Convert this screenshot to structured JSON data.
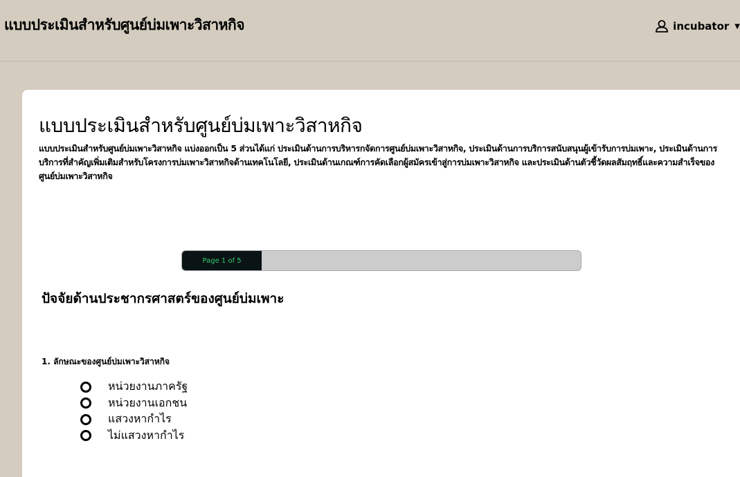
{
  "header": {
    "app_title": "แบบประเมินสำหรับศูนย์บ่มเพาะวิสาหกิจ",
    "user_name": "incubator",
    "user_icon": "user-icon",
    "caret_icon": "caret-down-icon"
  },
  "survey": {
    "title": "แบบประเมินสำหรับศูนย์บ่มเพาะวิสาหกิจ",
    "description": "แบบประเมินสำหรับศูนย์บ่มเพาะวิสาหกิจ แบ่งออกเป็น 5 ส่วนได้แก่ ประเมินด้านการบริหารกจัดการศูนย์บ่มเพาะวิสาหกิจ, ประเมินด้านการบริการสนับสนุนผู้เข้ารับการบ่มเพาะ, ประเมินด้านการบริการที่สำคัญเพิ่มเติมสำหรับโครงการบ่มเพาะวิสาหกิจด้านเทคโนโลยี, ประเมินด้านเกณฑ์การคัดเลือกผู้สมัครเข้าสู่การบ่มเพาะวิสาหกิจ และประเมินด้านตัวชี้วัดผลสัมฤทธิ์และความสำเร็จของศูนย์บ่มเพาะวิสาหกิจ"
  },
  "progress": {
    "label": "Page 1 of 5",
    "fraction": 0.2
  },
  "page": {
    "title": "ปัจจัยด้านประชากรศาสตร์ของศูนย์บ่มเพาะ"
  },
  "question": {
    "text": "1. ลักษณะของศูนย์บ่มเพาะวิสาหกิจ",
    "options": [
      "หน่วยงานภาครัฐ",
      "หน่วยงานเอกชน",
      "แสวงหากำไร",
      "ไม่แสวงหากำไร"
    ]
  },
  "colors": {
    "background": "#d4cdbf",
    "card": "#ffffff",
    "progress_fill": "#0b1414",
    "progress_text": "#2ecc71",
    "progress_track": "#cccccc"
  }
}
